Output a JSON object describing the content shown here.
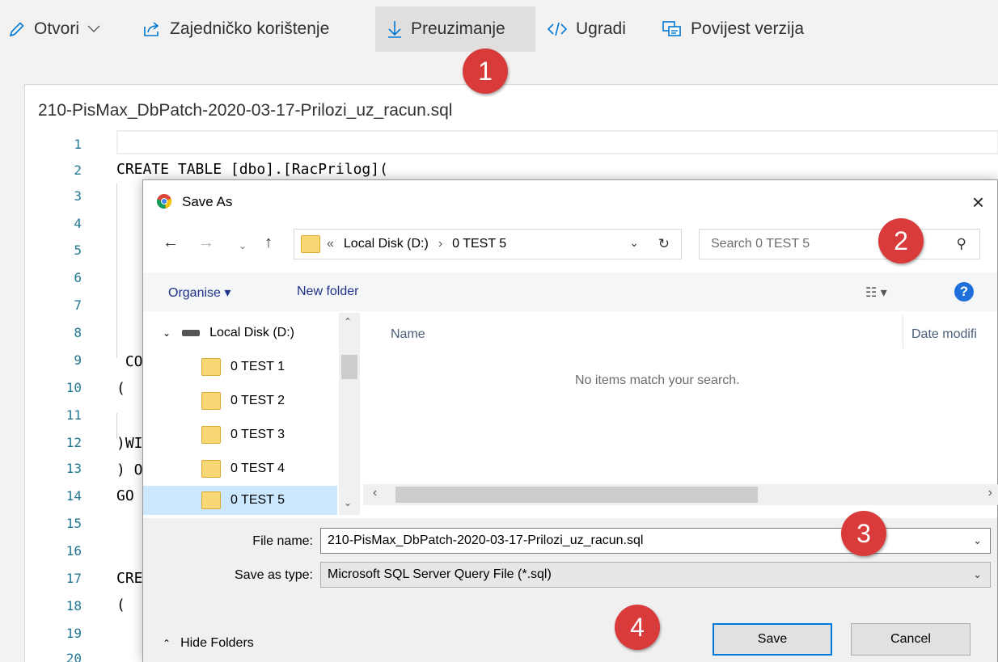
{
  "toolbar": {
    "open": "Otvori",
    "share": "Zajedničko korištenje",
    "download": "Preuzimanje",
    "embed": "Ugradi",
    "version_history": "Povijest verzija"
  },
  "editor": {
    "file_title": "210-PisMax_DbPatch-2020-03-17-Prilozi_uz_racun.sql",
    "line_numbers": [
      "1",
      "2",
      "3",
      "4",
      "5",
      "6",
      "7",
      "8",
      "9",
      "10",
      "11",
      "12",
      "13",
      "14",
      "15",
      "16",
      "17",
      "18",
      "19",
      "20"
    ],
    "code_line_2": "CREATE TABLE [dbo].[RacPrilog](",
    "code_line_10": " CO",
    "code_line_11": "(",
    "code_line_13": ")WI",
    "code_line_14": ") O",
    "code_line_15": "GO",
    "code_line_18": "CRE",
    "code_line_19": "("
  },
  "dialog": {
    "title": "Save As",
    "close": "×",
    "address": {
      "overflow": "«",
      "drive": "Local Disk (D:)",
      "separator": "›",
      "current_folder": "0 TEST 5"
    },
    "search_placeholder": "Search 0 TEST 5",
    "organise": "Organise",
    "new_folder": "New folder",
    "help": "?",
    "tree": {
      "root": "Local Disk (D:)",
      "folders": [
        "0 TEST 1",
        "0 TEST 2",
        "0 TEST 3",
        "0 TEST 4",
        "0 TEST 5"
      ],
      "selected": "0 TEST 5"
    },
    "columns": {
      "name": "Name",
      "date_modified": "Date modifi"
    },
    "empty_message": "No items match your search.",
    "file_name_label": "File name:",
    "file_name_value": "210-PisMax_DbPatch-2020-03-17-Prilozi_uz_racun.sql",
    "save_as_type_label": "Save as type:",
    "save_as_type_value": "Microsoft SQL Server Query File (*.sql)",
    "hide_folders": "Hide Folders",
    "save": "Save",
    "cancel": "Cancel"
  },
  "callouts": [
    "1",
    "2",
    "3",
    "4"
  ],
  "colors": {
    "callout_red": "#d93b3b",
    "accent_blue": "#0078d7",
    "selection_blue": "#cce8ff",
    "line_number_teal": "#237893"
  }
}
